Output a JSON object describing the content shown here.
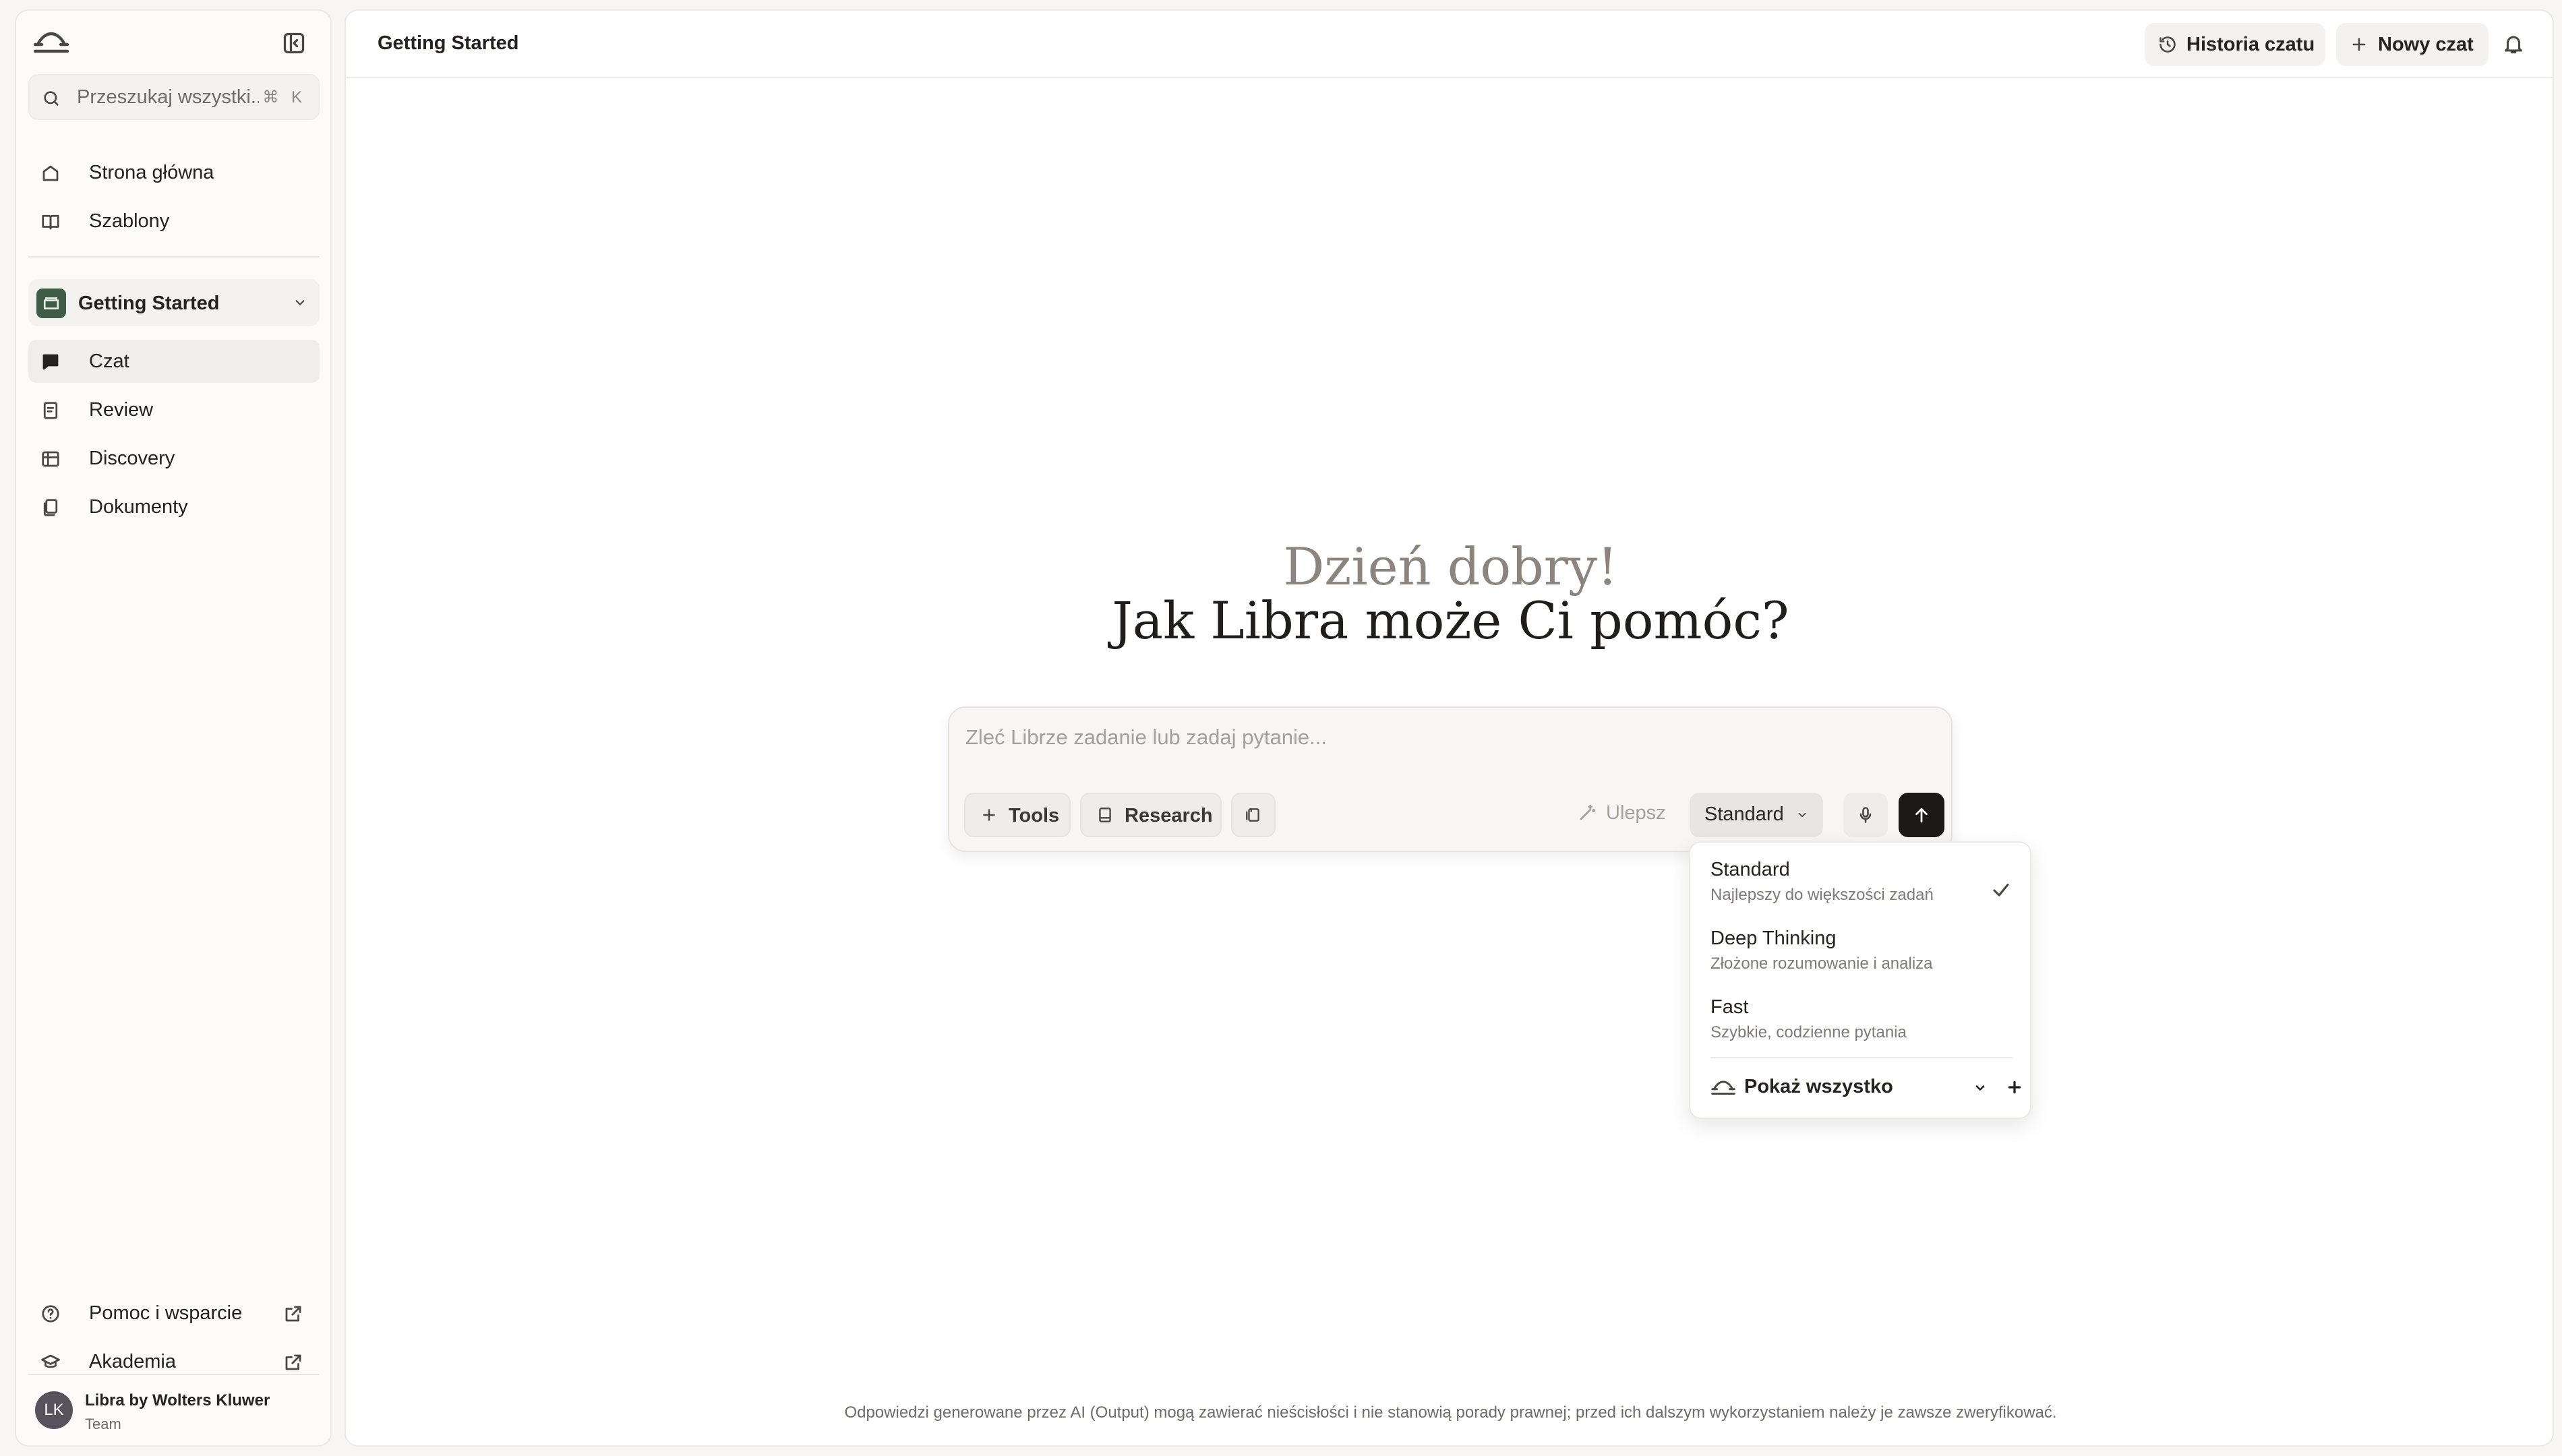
{
  "sidebar": {
    "search_placeholder": "Przeszukaj wszystki...",
    "search_shortcut": "⌘ K",
    "nav": [
      {
        "label": "Strona główna"
      },
      {
        "label": "Szablony"
      }
    ],
    "workspace": {
      "label": "Getting Started"
    },
    "workspace_nav": [
      {
        "label": "Czat"
      },
      {
        "label": "Review"
      },
      {
        "label": "Discovery"
      },
      {
        "label": "Dokumenty"
      }
    ],
    "footer_links": [
      {
        "label": "Pomoc i wsparcie"
      },
      {
        "label": "Akademia"
      }
    ],
    "user": {
      "initials": "LK",
      "name": "Libra by Wolters Kluwer",
      "plan": "Team"
    }
  },
  "header": {
    "title": "Getting Started",
    "history_label": "Historia czatu",
    "new_chat_label": "Nowy czat"
  },
  "greeting": {
    "line1": "Dzień dobry!",
    "line2": "Jak Libra może Ci pomóc?"
  },
  "composer": {
    "placeholder": "Zleć Librze zadanie lub zadaj pytanie...",
    "tools_label": "Tools",
    "research_label": "Research",
    "improve_label": "Ulepsz",
    "model_label": "Standard"
  },
  "model_menu": {
    "options": [
      {
        "name": "Standard",
        "desc": "Najlepszy do większości zadań",
        "selected": true
      },
      {
        "name": "Deep Thinking",
        "desc": "Złożone rozumowanie i analiza",
        "selected": false
      },
      {
        "name": "Fast",
        "desc": "Szybkie, codzienne pytania",
        "selected": false
      }
    ],
    "show_all_label": "Pokaż wszystko"
  },
  "disclaimer": "Odpowiedzi generowane przez AI (Output) mogą zawierać nieścisłości i nie stanowią porady prawnej; przed ich dalszym wykorzystaniem należy je zawsze zweryfikować.",
  "colors": {
    "accent_workspace": "#3e5c46",
    "send_button": "#1c1a18",
    "greeting_muted": "#8c857d"
  }
}
